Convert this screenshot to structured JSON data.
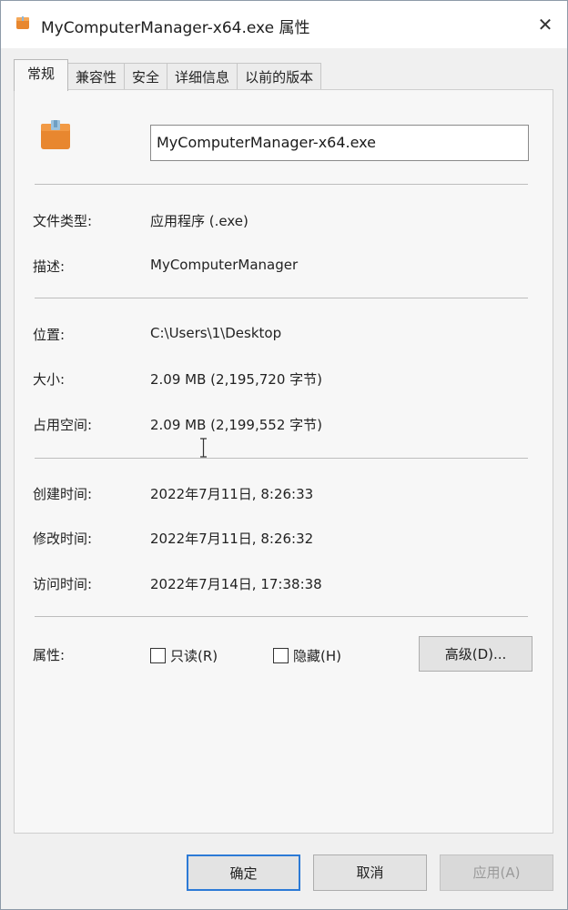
{
  "window": {
    "title": "MyComputerManager-x64.exe 属性",
    "close_glyph": "✕"
  },
  "tabs": [
    {
      "label": "常规",
      "active": true
    },
    {
      "label": "兼容性",
      "active": false
    },
    {
      "label": "安全",
      "active": false
    },
    {
      "label": "详细信息",
      "active": false
    },
    {
      "label": "以前的版本",
      "active": false
    }
  ],
  "general": {
    "file_name": "MyComputerManager-x64.exe",
    "file_type_label": "文件类型:",
    "file_type_value": "应用程序 (.exe)",
    "description_label": "描述:",
    "description_value": "MyComputerManager",
    "location_label": "位置:",
    "location_value": "C:\\Users\\1\\Desktop",
    "size_label": "大小:",
    "size_value": "2.09 MB (2,195,720 字节)",
    "disk_size_label": "占用空间:",
    "disk_size_value": "2.09 MB (2,199,552 字节)",
    "created_label": "创建时间:",
    "created_value": "2022年7月11日, 8:26:33",
    "modified_label": "修改时间:",
    "modified_value": "2022年7月11日, 8:26:32",
    "accessed_label": "访问时间:",
    "accessed_value": "2022年7月14日, 17:38:38",
    "attributes_label": "属性:",
    "readonly_label": "只读(R)",
    "readonly_checked": false,
    "hidden_label": "隐藏(H)",
    "hidden_checked": false,
    "advanced_button": "高级(D)..."
  },
  "footer": {
    "ok_label": "确定",
    "cancel_label": "取消",
    "apply_label": "应用(A)"
  },
  "colors": {
    "file_icon": "#e8872f",
    "focus_border": "#2c7ad6"
  },
  "icons": {
    "title_icon": "package-icon",
    "file_icon": "package-icon",
    "close": "close-icon",
    "cursor": "text-cursor-icon"
  }
}
